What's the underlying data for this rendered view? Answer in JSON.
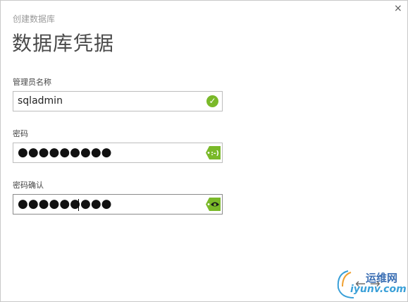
{
  "dialog": {
    "breadcrumb": "创建数据库",
    "title": "数据库凭据",
    "close_glyph": "×"
  },
  "fields": {
    "admin_name": {
      "label": "管理员名称",
      "value": "sqladmin",
      "status_icon": "check-circle-icon"
    },
    "password": {
      "label": "密码",
      "value": "●●●●●●●●●",
      "status_icon": "password-strength-icon"
    },
    "password_confirm": {
      "label": "密码确认",
      "value": "●●●●●●●●●",
      "status_icon": "reveal-password-icon"
    }
  },
  "colors": {
    "accent_green": "#7ab929",
    "border": "#bdbdbd"
  },
  "watermark": {
    "name": "运维网",
    "domain": "iyunv.com",
    "arrows": "←  →"
  }
}
